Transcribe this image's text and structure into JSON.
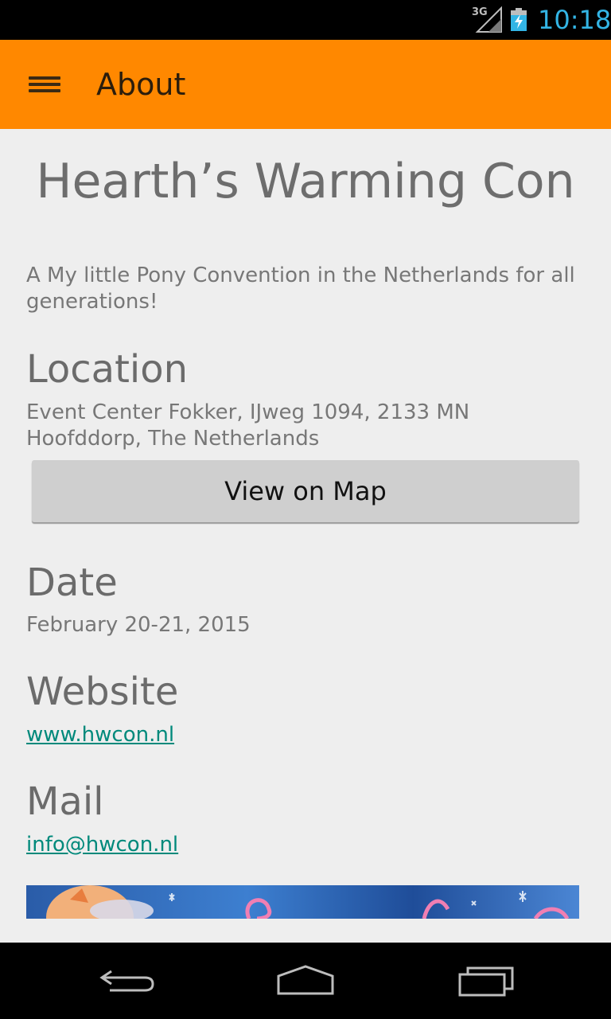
{
  "status_bar": {
    "network": "3G",
    "time": "10:18",
    "icons": [
      "signal-icon",
      "battery-charging-icon"
    ]
  },
  "app_bar": {
    "menu_icon": "menu-icon",
    "title": "About",
    "color": "#ff8800"
  },
  "about": {
    "heading": "Hearth’s Warming Con",
    "description": "A My little Pony Convention in the Netherlands for all generations!",
    "location": {
      "title": "Location",
      "text": "Event Center Fokker, IJweg 1094, 2133 MN Hoofddorp, The Netherlands",
      "button_label": "View on Map"
    },
    "date": {
      "title": "Date",
      "text": "February 20-21, 2015"
    },
    "website": {
      "title": "Website",
      "link": "www.hwcon.nl"
    },
    "mail": {
      "title": "Mail",
      "link": "info@hwcon.nl"
    }
  },
  "nav_bar": {
    "icons": [
      "back-icon",
      "home-icon",
      "recent-apps-icon"
    ]
  }
}
